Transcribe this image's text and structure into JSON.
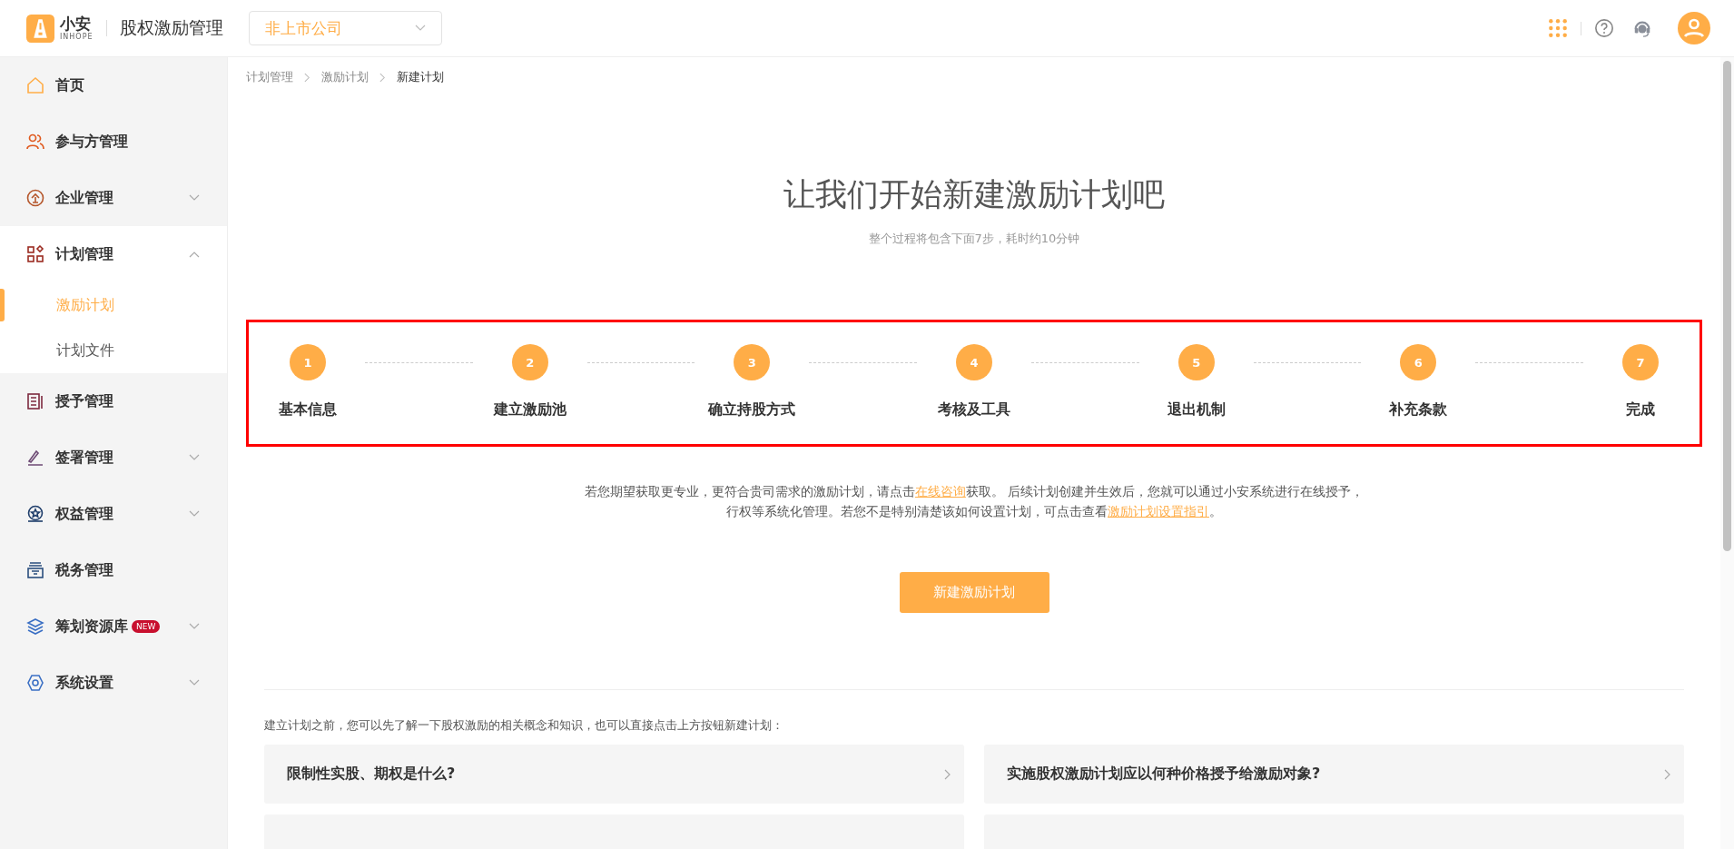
{
  "header": {
    "logo_text": "小安",
    "logo_sub": "INHOPE",
    "app_title": "股权激励管理",
    "company_select": {
      "value": "非上市公司"
    }
  },
  "sidebar": {
    "items": [
      {
        "label": "首页",
        "kind": "home"
      },
      {
        "label": "参与方管理",
        "kind": "people"
      },
      {
        "label": "企业管理",
        "kind": "company",
        "expanded": false
      },
      {
        "label": "计划管理",
        "kind": "plan",
        "expanded": true,
        "children": [
          {
            "label": "激励计划",
            "selected": true
          },
          {
            "label": "计划文件",
            "selected": false
          }
        ]
      },
      {
        "label": "授予管理",
        "kind": "grant"
      },
      {
        "label": "签署管理",
        "kind": "sign",
        "expanded": false
      },
      {
        "label": "权益管理",
        "kind": "equity",
        "expanded": false
      },
      {
        "label": "税务管理",
        "kind": "tax"
      },
      {
        "label": "筹划资源库",
        "kind": "layers",
        "badge": "NEW",
        "expanded": false
      },
      {
        "label": "系统设置",
        "kind": "settings",
        "expanded": false
      }
    ]
  },
  "breadcrumb": [
    "计划管理",
    "激励计划",
    "新建计划"
  ],
  "title": "让我们开始新建激励计划吧",
  "subtitle": "整个过程将包含下面7步，耗时约10分钟",
  "steps": [
    {
      "number": "1",
      "label": "基本信息"
    },
    {
      "number": "2",
      "label": "建立激励池"
    },
    {
      "number": "3",
      "label": "确立持股方式"
    },
    {
      "number": "4",
      "label": "考核及工具"
    },
    {
      "number": "5",
      "label": "退出机制"
    },
    {
      "number": "6",
      "label": "补充条款"
    },
    {
      "number": "7",
      "label": "完成"
    }
  ],
  "notice": {
    "part1": "若您期望获取更专业，更符合贵司需求的激励计划，请点击",
    "link1": "在线咨询",
    "part2": "获取。 后续计划创建并生效后，您就可以通过小安系统进行在线授予，行权等系统化管理。若您不是特别清楚该如何设置计划，可点击查看",
    "link2": "激励计划设置指引",
    "part3": "。"
  },
  "create_button": "新建激励计划",
  "intro": "建立计划之前，您可以先了解一下股权激励的相关概念和知识，也可以直接点击上方按钮新建计划：",
  "faq": [
    {
      "question": "限制性实股、期权是什么?"
    },
    {
      "question": "实施股权激励计划应以何种价格授予给激励对象?"
    }
  ]
}
